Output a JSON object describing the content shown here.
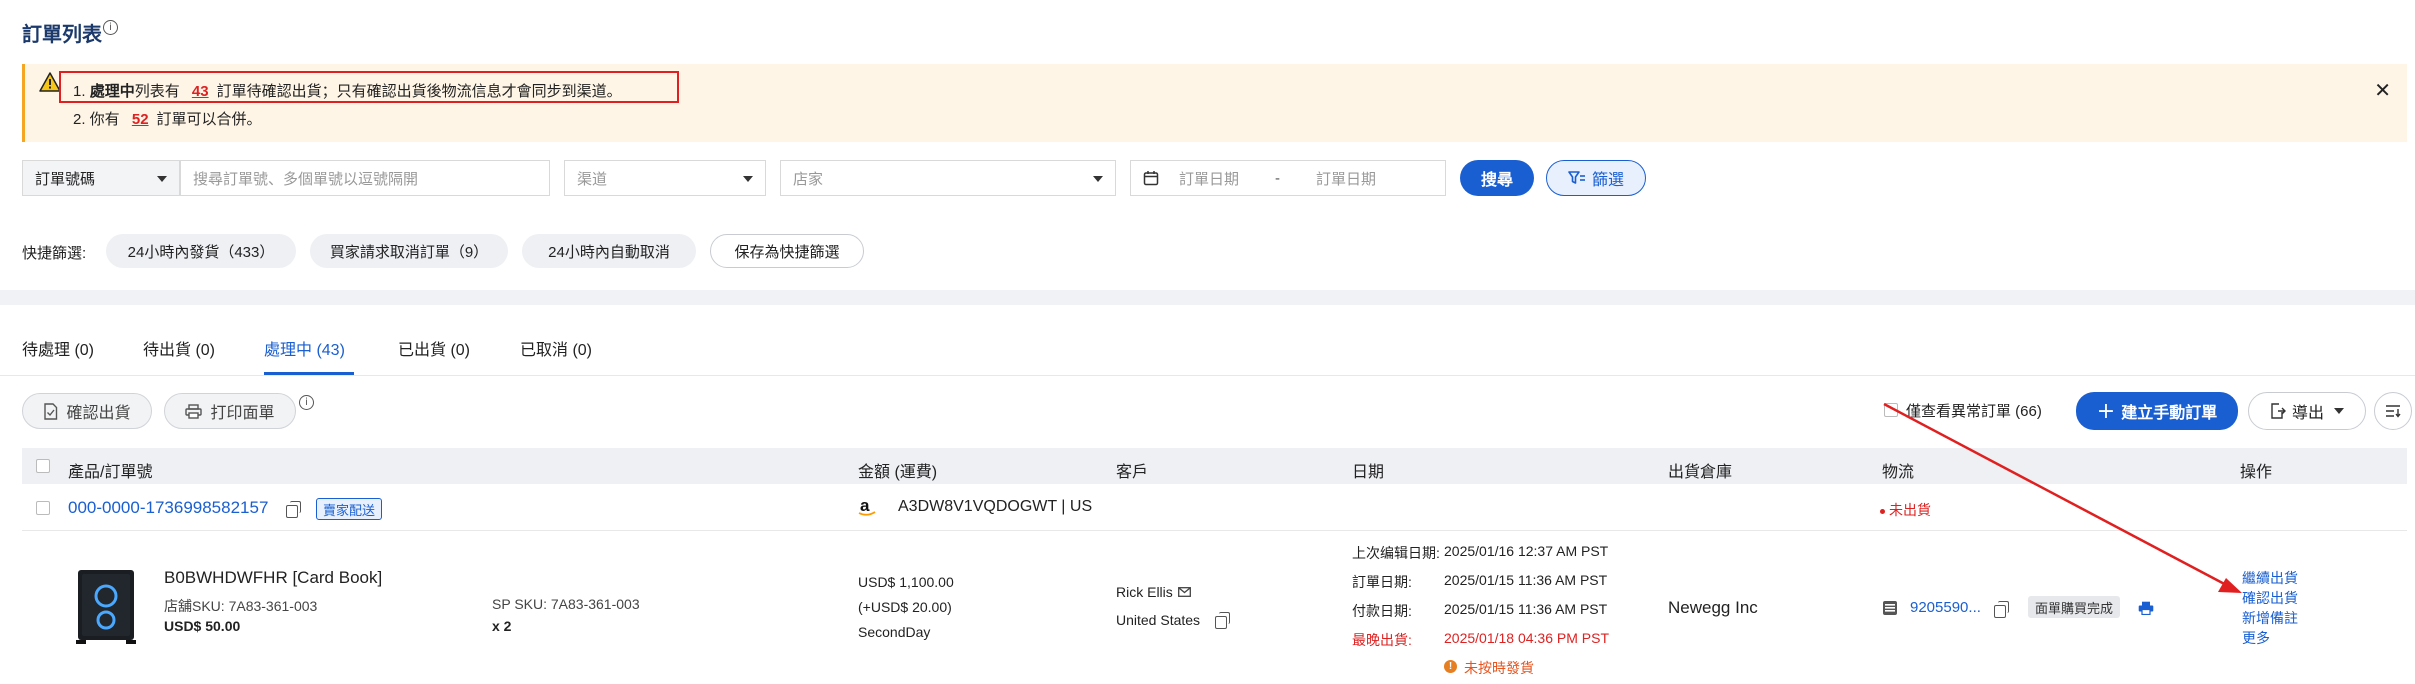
{
  "page": {
    "title": "訂單列表"
  },
  "alert": {
    "line1_prefix": "1.",
    "line1_bold": "處理中",
    "line1_mid": "列表有",
    "line1_count": "43",
    "line1_suffix": "訂單待確認出貨；只有確認出貨後物流信息才會同步到渠道。",
    "line2_prefix": "2. 你有",
    "line2_count": "52",
    "line2_suffix": "訂單可以合併。",
    "close": "✕"
  },
  "filters": {
    "search_type": "訂單號碼",
    "search_placeholder": "搜尋訂單號、多個單號以逗號隔開",
    "channel_placeholder": "渠道",
    "store_placeholder": "店家",
    "date_start_placeholder": "訂單日期",
    "date_separator": "-",
    "date_end_placeholder": "訂單日期",
    "search_button": "搜尋",
    "filter_button": "篩選"
  },
  "quick_filters": {
    "label": "快捷篩選:",
    "chips": [
      "24小時內發貨（433）",
      "買家請求取消訂單（9）",
      "24小時內自動取消"
    ],
    "save_button": "保存為快捷篩選"
  },
  "tabs": [
    {
      "label": "待處理 (0)"
    },
    {
      "label": "待出貨 (0)"
    },
    {
      "label": "處理中 (43)"
    },
    {
      "label": "已出貨 (0)"
    },
    {
      "label": "已取消 (0)"
    }
  ],
  "actions": {
    "confirm_ship": "確認出貨",
    "print_label": "打印面單",
    "abnormal_only": "僅查看異常訂單 (66)",
    "create_manual": "建立手動訂單",
    "export": "導出"
  },
  "table": {
    "headers": [
      "產品/訂單號",
      "金額 (運費)",
      "客戶",
      "日期",
      "出貨倉庫",
      "物流",
      "操作"
    ]
  },
  "order": {
    "order_no": "000-0000-1736998582157",
    "seller_ship_tag": "賣家配送",
    "channel_account": "A3DW8V1VQDOGWT | US",
    "ship_status": "未出貨",
    "product_name": "B0BWHDWFHR [Card Book]",
    "store_sku": "店舖SKU: 7A83-361-003",
    "unit_price": "USD$ 50.00",
    "sp_sku": "SP SKU: 7A83-361-003",
    "qty": "x 2",
    "amount": "USD$ 1,100.00",
    "shipping": "(+USD$ 20.00)",
    "ship_method": "SecondDay",
    "customer_name": "Rick Ellis",
    "customer_country": "United States",
    "dates": [
      {
        "label": "上次编辑日期:",
        "value": "2025/01/16 12:37 AM PST"
      },
      {
        "label": "訂單日期:",
        "value": "2025/01/15 11:36 AM PST"
      },
      {
        "label": "付款日期:",
        "value": "2025/01/15 11:36 AM PST"
      },
      {
        "label": "最晚出貨:",
        "value": "2025/01/18 04:36 PM PST"
      }
    ],
    "late_warning": "未按時發貨",
    "warehouse": "Newegg Inc",
    "tracking_no": "9205590...",
    "label_status": "面單購買完成",
    "ops": [
      "繼續出貨",
      "確認出貨",
      "新增備註",
      "更多"
    ]
  },
  "colors": {
    "primary": "#1a5fd1",
    "alert_bg": "#fef5e6",
    "alert_border": "#f5a623",
    "annotation_red": "#e02020",
    "danger": "#dd2222"
  }
}
